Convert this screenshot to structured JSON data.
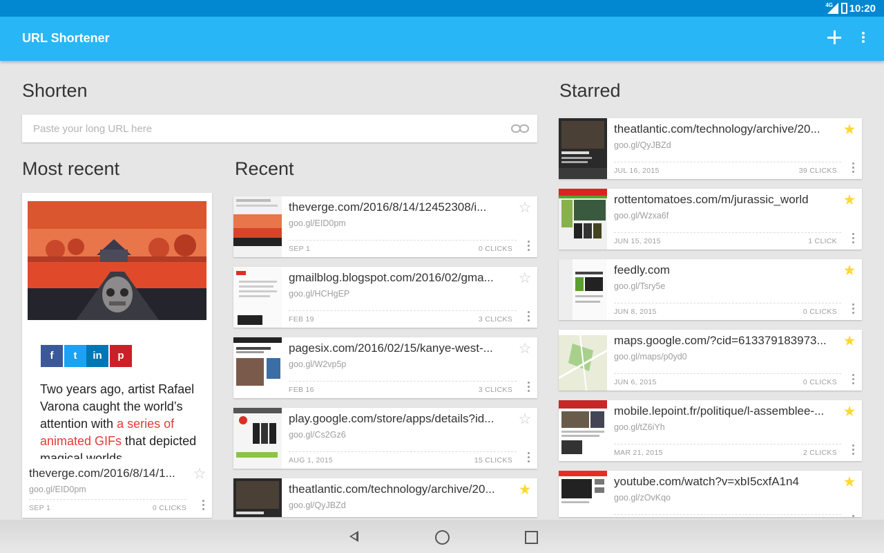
{
  "status_bar": {
    "time": "10:20",
    "network": "4G"
  },
  "app_bar": {
    "title": "URL Shortener",
    "add_icon": "plus-icon",
    "menu_icon": "more-vert-icon"
  },
  "shorten": {
    "heading": "Shorten",
    "placeholder": "Paste your long URL here",
    "icon": "link-icon"
  },
  "most_recent": {
    "heading": "Most recent",
    "share": [
      {
        "label": "f",
        "color": "#3b5998"
      },
      {
        "label": "t",
        "color": "#1da1f2"
      },
      {
        "label": "in",
        "color": "#0077b5"
      },
      {
        "label": "p",
        "color": "#cb2027"
      }
    ],
    "desc_pre": "Two years ago, artist Rafael Varona caught the world’s attention with ",
    "desc_link": "a series of animated GIFs",
    "desc_post": " that depicted magical worlds",
    "url": "theverge.com/2016/8/14/1...",
    "short": "goo.gl/EID0pm",
    "date": "SEP 1",
    "clicks": "0 CLICKS"
  },
  "recent": {
    "heading": "Recent",
    "items": [
      {
        "url": "theverge.com/2016/8/14/12452308/i...",
        "short": "goo.gl/EID0pm",
        "date": "SEP 1",
        "clicks": "0 CLICKS",
        "starred": false,
        "thumb": "verge"
      },
      {
        "url": "gmailblog.blogspot.com/2016/02/gma...",
        "short": "goo.gl/HCHgEP",
        "date": "FEB 19",
        "clicks": "3 CLICKS",
        "starred": false,
        "thumb": "gmail"
      },
      {
        "url": "pagesix.com/2016/02/15/kanye-west-...",
        "short": "goo.gl/W2vp5p",
        "date": "FEB 16",
        "clicks": "3 CLICKS",
        "starred": false,
        "thumb": "pagesix"
      },
      {
        "url": "play.google.com/store/apps/details?id...",
        "short": "goo.gl/Cs2Gz6",
        "date": "AUG 1, 2015",
        "clicks": "15 CLICKS",
        "starred": false,
        "thumb": "play"
      },
      {
        "url": "theatlantic.com/technology/archive/20...",
        "short": "goo.gl/QyJBZd",
        "date": "",
        "clicks": "",
        "starred": true,
        "thumb": "atlantic"
      }
    ]
  },
  "starred": {
    "heading": "Starred",
    "items": [
      {
        "url": "theatlantic.com/technology/archive/20...",
        "short": "goo.gl/QyJBZd",
        "date": "JUL 16, 2015",
        "clicks": "39 CLICKS",
        "starred": true,
        "thumb": "atlantic"
      },
      {
        "url": "rottentomatoes.com/m/jurassic_world",
        "short": "goo.gl/Wzxa6f",
        "date": "JUN 15, 2015",
        "clicks": "1 CLICK",
        "starred": true,
        "thumb": "rotten"
      },
      {
        "url": "feedly.com",
        "short": "goo.gl/Tsry5e",
        "date": "JUN 8, 2015",
        "clicks": "0 CLICKS",
        "starred": true,
        "thumb": "feedly"
      },
      {
        "url": "maps.google.com/?cid=613379183973...",
        "short": "goo.gl/maps/p0yd0",
        "date": "JUN 6, 2015",
        "clicks": "0 CLICKS",
        "starred": true,
        "thumb": "maps"
      },
      {
        "url": "mobile.lepoint.fr/politique/l-assemblee-...",
        "short": "goo.gl/tZ6iYh",
        "date": "MAR 21, 2015",
        "clicks": "2 CLICKS",
        "starred": true,
        "thumb": "lepoint"
      },
      {
        "url": "youtube.com/watch?v=xbI5cxfA1n4",
        "short": "goo.gl/zOvKqo",
        "date": "",
        "clicks": "",
        "starred": true,
        "thumb": "youtube"
      }
    ]
  },
  "colors": {
    "accent": "#29b6f6",
    "status_bar": "#0288d1",
    "star": "#fdd835",
    "link": "#e53935"
  },
  "nav": {
    "back_icon": "back-icon",
    "home_icon": "home-icon",
    "recents_icon": "recents-icon"
  }
}
